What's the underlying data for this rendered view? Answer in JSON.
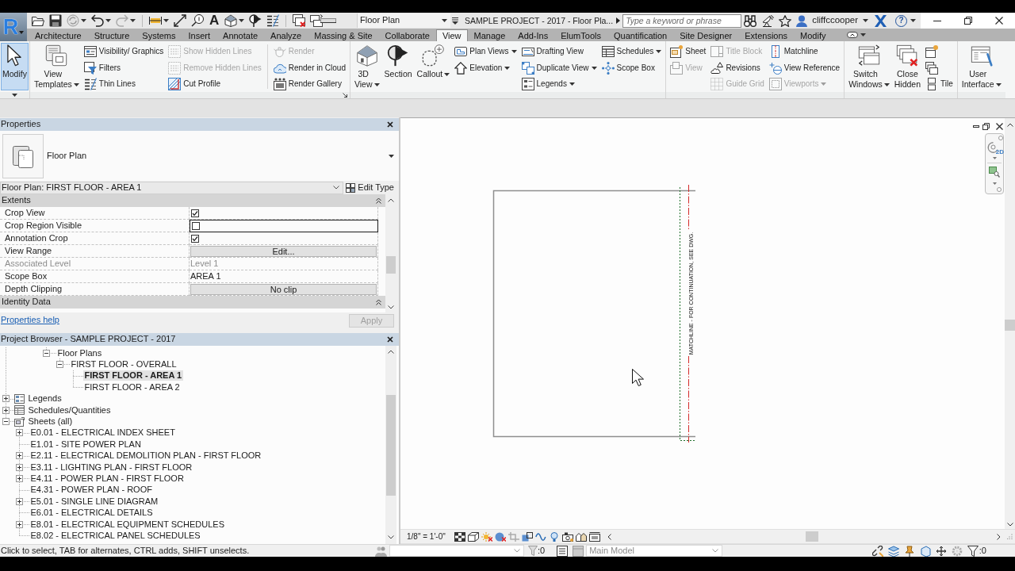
{
  "app": {
    "logo": "R"
  },
  "quick_access": {
    "text_glyph": "A",
    "view_selector": "Floor Plan",
    "title": "SAMPLE PROJECT - 2017 - Floor Pla...",
    "search": {
      "placeholder": "Type a keyword or phrase"
    },
    "user": "cliffccooper",
    "help_glyph": "?"
  },
  "ribbon": {
    "tabs": [
      {
        "label": "Architecture",
        "selected": false
      },
      {
        "label": "Structure",
        "selected": false
      },
      {
        "label": "Systems",
        "selected": false
      },
      {
        "label": "Insert",
        "selected": false
      },
      {
        "label": "Annotate",
        "selected": false
      },
      {
        "label": "Analyze",
        "selected": false
      },
      {
        "label": "Massing & Site",
        "selected": false
      },
      {
        "label": "Collaborate",
        "selected": false
      },
      {
        "label": "View",
        "selected": true
      },
      {
        "label": "Manage",
        "selected": false
      },
      {
        "label": "Add-Ins",
        "selected": false
      },
      {
        "label": "ElumTools",
        "selected": false
      },
      {
        "label": "Quantification",
        "selected": false
      },
      {
        "label": "Site Designer",
        "selected": false
      },
      {
        "label": "Extensions",
        "selected": false
      },
      {
        "label": "Modify",
        "selected": false
      }
    ],
    "panels": [
      {
        "menu": true,
        "launcher": false,
        "items": [
          {
            "kind": "large",
            "label": "Modify",
            "active": true,
            "disabled": false,
            "dropdown": false
          }
        ]
      },
      {
        "menu": false,
        "launcher": true,
        "items": [
          {
            "kind": "large",
            "label": "View Templates",
            "active": false,
            "disabled": false,
            "dropdown": true
          },
          {
            "kind": "stack",
            "tools": [
              {
                "label": "Visibility/ Graphics",
                "active": false,
                "disabled": false,
                "dropdown": false
              },
              {
                "label": "Filters",
                "active": false,
                "disabled": false,
                "dropdown": false
              },
              {
                "label": "Thin Lines",
                "active": false,
                "disabled": false,
                "dropdown": false
              }
            ]
          },
          {
            "kind": "stack",
            "tools": [
              {
                "label": "Show Hidden Lines",
                "active": false,
                "disabled": true,
                "dropdown": false
              },
              {
                "label": "Remove Hidden Lines",
                "active": false,
                "disabled": true,
                "dropdown": false
              },
              {
                "label": "Cut Profile",
                "active": false,
                "disabled": false,
                "dropdown": false
              }
            ]
          },
          {
            "kind": "separator"
          },
          {
            "kind": "stack",
            "tools": [
              {
                "label": "Render",
                "active": false,
                "disabled": true,
                "dropdown": false
              },
              {
                "label": "Render in Cloud",
                "active": false,
                "disabled": false,
                "dropdown": false
              },
              {
                "label": "Render Gallery",
                "active": false,
                "disabled": false,
                "dropdown": false
              }
            ]
          }
        ]
      },
      {
        "menu": false,
        "launcher": false,
        "items": [
          {
            "kind": "large",
            "label": "3D View",
            "active": false,
            "disabled": false,
            "dropdown": true
          },
          {
            "kind": "large",
            "label": "Section",
            "active": false,
            "disabled": false,
            "dropdown": false
          },
          {
            "kind": "large",
            "label": "Callout",
            "active": false,
            "disabled": false,
            "dropdown": true
          },
          {
            "kind": "stack",
            "tools": [
              {
                "label": "Plan Views",
                "active": false,
                "disabled": false,
                "dropdown": true
              },
              {
                "label": "Elevation",
                "active": false,
                "disabled": false,
                "dropdown": true
              }
            ]
          },
          {
            "kind": "stack",
            "tools": [
              {
                "label": "Drafting View",
                "active": false,
                "disabled": false,
                "dropdown": false
              },
              {
                "label": "Duplicate View",
                "active": false,
                "disabled": false,
                "dropdown": true
              },
              {
                "label": "Legends",
                "active": false,
                "disabled": false,
                "dropdown": true
              }
            ]
          },
          {
            "kind": "stack",
            "tools": [
              {
                "label": "Schedules",
                "active": false,
                "disabled": false,
                "dropdown": true
              },
              {
                "label": "Scope Box",
                "active": false,
                "disabled": false,
                "dropdown": false
              }
            ]
          }
        ]
      },
      {
        "menu": false,
        "launcher": false,
        "items": [
          {
            "kind": "stack",
            "tools": [
              {
                "label": "Sheet",
                "active": false,
                "disabled": false,
                "dropdown": false
              },
              {
                "label": "View",
                "active": false,
                "disabled": true,
                "dropdown": false
              }
            ]
          },
          {
            "kind": "stack",
            "tools": [
              {
                "label": "Title Block",
                "active": false,
                "disabled": true,
                "dropdown": false
              },
              {
                "label": "Revisions",
                "active": false,
                "disabled": false,
                "dropdown": false
              },
              {
                "label": "Guide Grid",
                "active": false,
                "disabled": true,
                "dropdown": false
              }
            ]
          },
          {
            "kind": "stack",
            "tools": [
              {
                "label": "Matchline",
                "active": false,
                "disabled": false,
                "dropdown": false
              },
              {
                "label": "View Reference",
                "active": false,
                "disabled": false,
                "dropdown": false
              },
              {
                "label": "Viewports",
                "active": false,
                "disabled": true,
                "dropdown": true
              }
            ]
          }
        ]
      },
      {
        "menu": false,
        "launcher": false,
        "items": [
          {
            "kind": "large",
            "label": "Switch Windows",
            "active": false,
            "disabled": false,
            "dropdown": true
          },
          {
            "kind": "large",
            "label": "Close Hidden",
            "active": false,
            "disabled": false,
            "dropdown": false
          },
          {
            "kind": "stack",
            "tools": [
              {
                "active": false,
                "disabled": false,
                "dropdown": false
              },
              {
                "active": false,
                "disabled": false,
                "dropdown": false
              },
              {
                "label": "Tile",
                "active": false,
                "disabled": false,
                "dropdown": false
              }
            ]
          }
        ]
      },
      {
        "menu": false,
        "launcher": false,
        "items": [
          {
            "kind": "large",
            "label": "User Interface",
            "active": false,
            "disabled": false,
            "dropdown": true
          }
        ]
      }
    ]
  },
  "properties": {
    "title": "Properties",
    "type_name": "Floor Plan",
    "instance": "Floor Plan: FIRST FLOOR - AREA 1",
    "edit_type": "Edit Type",
    "groups": [
      {
        "name": "Extents",
        "expanded": true,
        "rows": [
          {
            "name": "Crop View",
            "kind": "checkbox",
            "checked": true,
            "disabled": false,
            "focused": false
          },
          {
            "name": "Crop Region Visible",
            "kind": "checkbox",
            "checked": false,
            "disabled": false,
            "focused": true
          },
          {
            "name": "Annotation Crop",
            "kind": "checkbox",
            "checked": true,
            "disabled": false,
            "focused": false
          },
          {
            "name": "View Range",
            "kind": "button",
            "value": "Edit...",
            "disabled": false,
            "focused": false
          },
          {
            "name": "Associated Level",
            "kind": "text",
            "value": "Level 1",
            "disabled": true,
            "focused": false
          },
          {
            "name": "Scope Box",
            "kind": "text",
            "value": "AREA 1",
            "disabled": false,
            "focused": false
          },
          {
            "name": "Depth Clipping",
            "kind": "button",
            "value": "No clip",
            "disabled": false,
            "focused": false
          }
        ]
      },
      {
        "name": "Identity Data",
        "expanded": true
      }
    ],
    "help_link": "Properties help",
    "apply": {
      "label": "Apply",
      "disabled": true
    }
  },
  "project_browser": {
    "title": "Project Browser - SAMPLE PROJECT - 2017",
    "tree": [
      {
        "children": [
          {
            "children": [
              {
                "children": [
                  {
                    "label": "Floor Plans",
                    "expanded": true,
                    "selected": false,
                    "children": [
                      {
                        "label": "FIRST FLOOR - OVERALL",
                        "expanded": true,
                        "selected": false,
                        "children": [
                          {
                            "label": "FIRST FLOOR - AREA 1",
                            "selected": true
                          },
                          {
                            "label": "FIRST FLOOR - AREA 2",
                            "selected": false
                          }
                        ]
                      }
                    ]
                  }
                ]
              }
            ]
          }
        ]
      },
      {
        "label": "Legends",
        "expanded": false,
        "selected": false
      },
      {
        "label": "Schedules/Quantities",
        "expanded": false,
        "selected": false
      },
      {
        "label": "Sheets (all)",
        "expanded": true,
        "selected": false,
        "children": [
          {
            "label": "E0.01 - ELECTRICAL INDEX SHEET",
            "expanded": false,
            "selected": false
          },
          {
            "label": "E1.01 - SITE POWER PLAN",
            "selected": false
          },
          {
            "label": "E2.11 - ELECTRICAL DEMOLITION PLAN - FIRST FLOOR",
            "expanded": false,
            "selected": false
          },
          {
            "label": "E3.11 - LIGHTING PLAN - FIRST FLOOR",
            "expanded": false,
            "selected": false
          },
          {
            "label": "E4.11 - POWER PLAN - FIRST FLOOR",
            "expanded": false,
            "selected": false
          },
          {
            "label": "E4.31 - POWER PLAN - ROOF",
            "selected": false
          },
          {
            "label": "E5.01 - SINGLE LINE DIAGRAM",
            "expanded": false,
            "selected": false
          },
          {
            "label": "E6.01 - ELECTRICAL DETAILS",
            "selected": false
          },
          {
            "label": "E8.01 - ELECTRICAL EQUIPMENT SCHEDULES",
            "expanded": false,
            "selected": false
          },
          {
            "label": "E8.02 - ELECTRICAL PANEL SCHEDULES",
            "selected": false
          }
        ]
      }
    ]
  },
  "canvas": {
    "matchline_label": "MATCHLINE - FOR CONTINUATION, SEE DWG.",
    "nav_wheel_label": "2D"
  },
  "view_control_bar": {
    "scale": "1/8\" = 1'-0\""
  },
  "status_bar": {
    "message": "Click to select, TAB for alternates, CTRL adds, SHIFT unselects.",
    "counter": ":0",
    "design_option": {
      "value": "Main Model",
      "disabled": true
    },
    "filter_count": ":0"
  }
}
